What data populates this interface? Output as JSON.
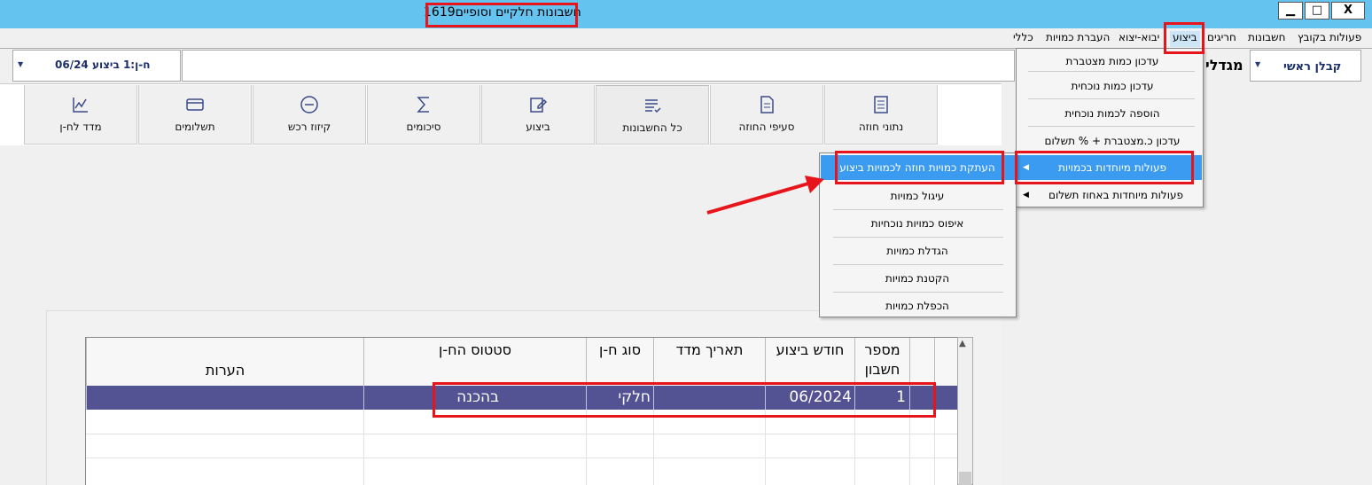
{
  "window": {
    "title_number": "1619",
    "title_text": "חשבונות חלקיים וסופיים",
    "btn_minimize": "▁",
    "btn_maximize": "□",
    "btn_close": "X"
  },
  "menubar": {
    "items": [
      "פעולות בקובץ",
      "ביצוע",
      "חשבונות",
      "חריגים",
      "יבוא-יצוא",
      "העברת כמויות",
      "כללי"
    ]
  },
  "toolbar": {
    "left_combo": "ח-ן:1 ביצוע 06/24",
    "right_combo": "קבלן ראשי",
    "partial_label": "מגדלי"
  },
  "tabs": [
    {
      "label": "נתוני חוזה",
      "icon": "notebook-icon"
    },
    {
      "label": "סעיפי החוזה",
      "icon": "document-icon"
    },
    {
      "label": "כל החשבונות",
      "icon": "list-check-icon"
    },
    {
      "label": "ביצוע",
      "icon": "edit-icon"
    },
    {
      "label": "סיכומים",
      "icon": "sigma-icon"
    },
    {
      "label": "קיזוז רכש",
      "icon": "minus-circle-icon"
    },
    {
      "label": "תשלומים",
      "icon": "card-icon"
    },
    {
      "label": "מדד לח-ן",
      "icon": "chart-icon"
    }
  ],
  "execution_menu": {
    "items": [
      "עדכון כמות מצטברת",
      "עדכון כמות נוכחית",
      "הוספה לכמות נוכחית",
      "עדכון כ.מצטברת + % תשלום",
      "פעולות מיוחדות בכמויות",
      "פעולות מיוחדות באחוז תשלום"
    ]
  },
  "special_menu": {
    "items": [
      "העתקת כמויות חוזה לכמויות ביצוע",
      "עיגול כמויות",
      "איפוס כמויות נוכחיות",
      "הגדלת כמויות",
      "הקטנת כמויות",
      "הכפלת כמויות"
    ]
  },
  "grid": {
    "headers": {
      "account": "מספר חשבון",
      "month": "חודש ביצוע",
      "index_date": "תאריך מדד",
      "type": "סוג ח-ן",
      "status": "סטטוס הח-ן",
      "notes": "הערות"
    },
    "rows": [
      {
        "account": "1",
        "month": "06/2024",
        "index_date": "",
        "type": "חלקי",
        "status": "בהכנה",
        "notes": ""
      }
    ]
  }
}
